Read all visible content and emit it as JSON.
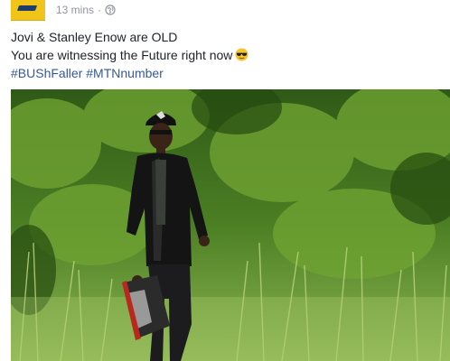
{
  "post": {
    "timestamp": "13 mins",
    "separator": "·",
    "privacy_icon": "globe-icon",
    "lines": [
      "Jovi & Stanley Enow are OLD",
      "You are witnessing the Future right now"
    ],
    "emoji": "sunglasses-emoji",
    "hashtags": [
      "#BUShFaller",
      "#MTNnumber"
    ]
  },
  "colors": {
    "brand_yellow": "#f0c419",
    "link_blue": "#365899",
    "text": "#1d2129",
    "meta_grey": "#90949c"
  }
}
